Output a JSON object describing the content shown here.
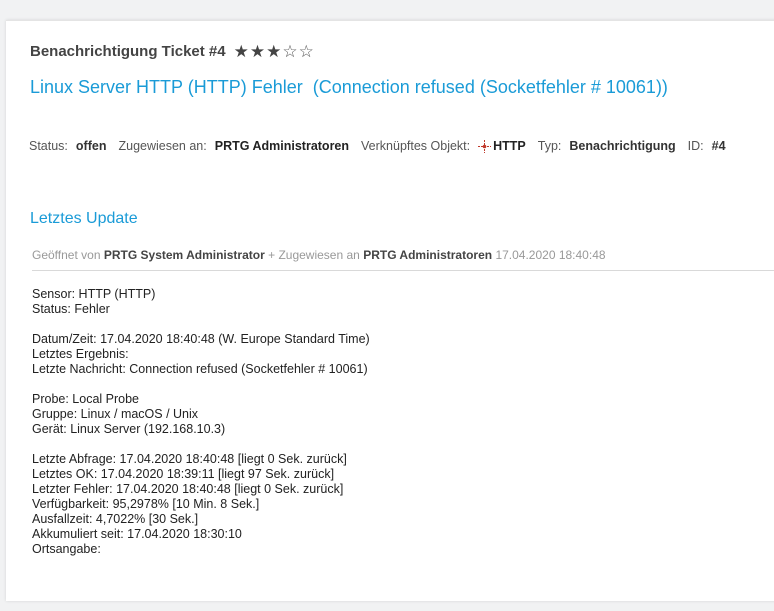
{
  "ticket": {
    "title": "Benachrichtigung Ticket #4",
    "rating": 3,
    "rating_max": 5,
    "headline": "Linux Server HTTP (HTTP) Fehler  (Connection refused (Socketfehler # 10061))"
  },
  "meta": {
    "status_label": "Status:",
    "status_value": "offen",
    "assigned_label": "Zugewiesen an:",
    "assigned_value": "PRTG Administratoren",
    "linked_label": "Verknüpftes Objekt:",
    "linked_value": "HTTP",
    "type_label": "Typ:",
    "type_value": "Benachrichtigung",
    "id_label": "ID:",
    "id_value": "#4"
  },
  "update": {
    "section_title": "Letztes Update",
    "opened_by_label": "Geöffnet von",
    "opened_by": "PRTG System Administrator",
    "assigned_label": "+ Zugewiesen an",
    "assigned_to": "PRTG Administratoren",
    "timestamp": "17.04.2020 18:40:48"
  },
  "message": {
    "block1": [
      "Sensor: HTTP (HTTP)",
      "Status: Fehler"
    ],
    "block2": [
      "Datum/Zeit: 17.04.2020 18:40:48 (W. Europe Standard Time)",
      "Letztes Ergebnis:",
      "Letzte Nachricht: Connection refused (Socketfehler # 10061)"
    ],
    "block3": [
      "Probe: Local Probe",
      "Gruppe: Linux / macOS / Unix",
      "Gerät: Linux Server (192.168.10.3)"
    ],
    "block4": [
      "Letzte Abfrage: 17.04.2020 18:40:48 [liegt 0 Sek. zurück]",
      "Letztes OK: 17.04.2020 18:39:11 [liegt 97 Sek. zurück]",
      "Letzter Fehler: 17.04.2020 18:40:48 [liegt 0 Sek. zurück]",
      "Verfügbarkeit: 95,2978% [10 Min. 8 Sek.]",
      "Ausfallzeit: 4,7022% [30 Sek.]",
      "Akkumuliert seit: 17.04.2020 18:30:10",
      "Ortsangabe:"
    ]
  },
  "colors": {
    "accent": "#1a9bd7",
    "sensor_icon": "#c0392b"
  }
}
